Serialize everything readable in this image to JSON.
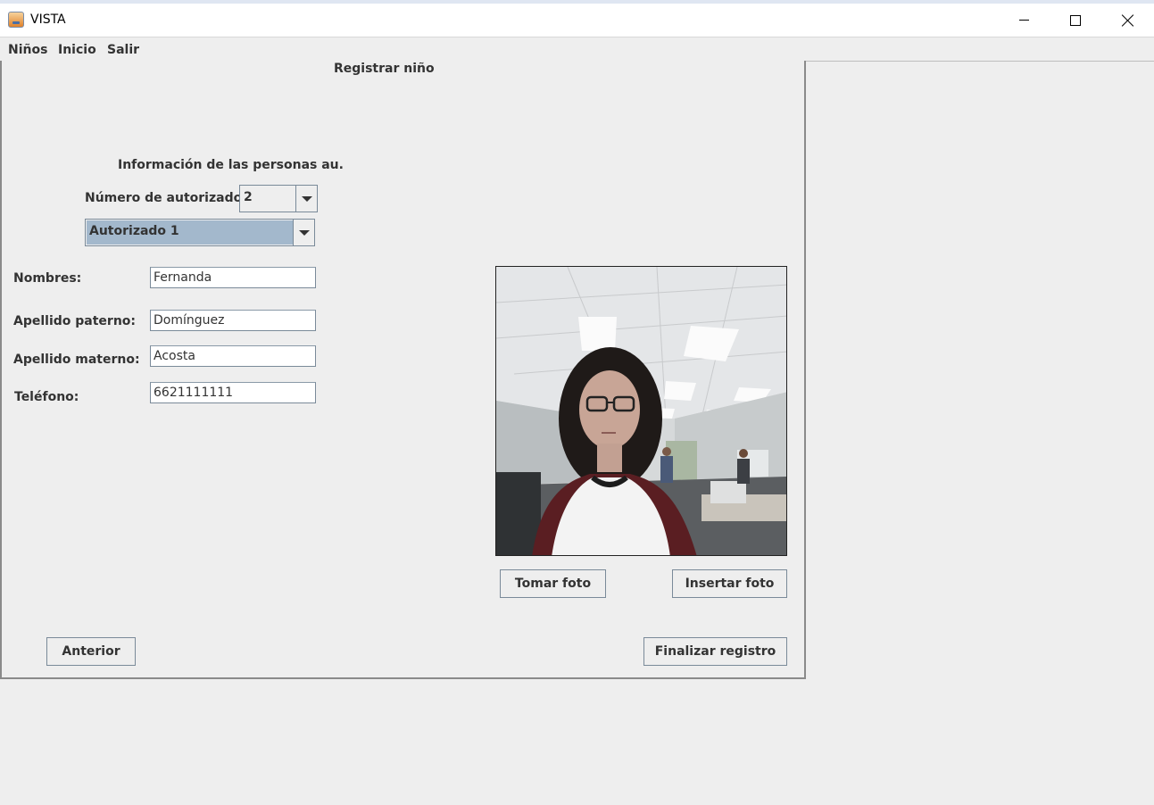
{
  "window": {
    "title": "VISTA",
    "icon": "java-cup-icon"
  },
  "menu": {
    "items": [
      "Niños",
      "Inicio",
      "Salir"
    ]
  },
  "form": {
    "title": "Registrar niño",
    "section_title": "Información de las personas au.",
    "count_label": "Número de autorizados:",
    "count_value": "2",
    "selected_person": "Autorizado 1",
    "fields": {
      "nombres": {
        "label": "Nombres:",
        "value": "Fernanda"
      },
      "paterno": {
        "label": "Apellido paterno:",
        "value": "Domínguez"
      },
      "materno": {
        "label": "Apellido materno:",
        "value": "Acosta"
      },
      "telefono": {
        "label": "Teléfono:",
        "value": "6621111111"
      }
    }
  },
  "photo": {
    "description_icon": "webcam-photo"
  },
  "buttons": {
    "take_photo": "Tomar foto",
    "insert_photo": "Insertar foto",
    "previous": "Anterior",
    "finish": "Finalizar registro"
  },
  "colors": {
    "background": "#eeeeee",
    "selection": "#a3b8cc",
    "border": "#7a8a99"
  }
}
